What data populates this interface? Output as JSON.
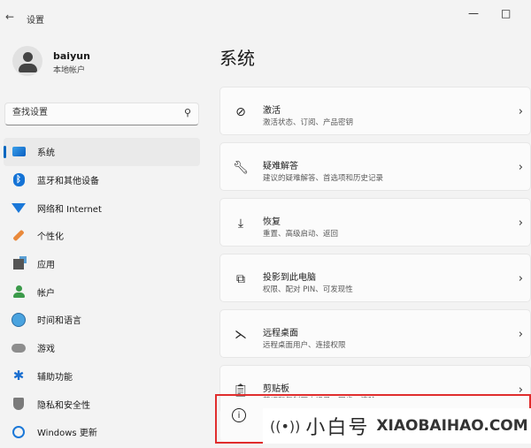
{
  "window": {
    "title": "设置",
    "back_icon": "back-arrow-icon",
    "minimize": "—",
    "maximize": "□"
  },
  "user": {
    "name": "baiyun",
    "account_type": "本地帐户"
  },
  "search": {
    "placeholder": "查找设置"
  },
  "sidebar": {
    "items": [
      {
        "label": "系统",
        "icon": "system-icon",
        "active": true
      },
      {
        "label": "蓝牙和其他设备",
        "icon": "bluetooth-icon"
      },
      {
        "label": "网络和 Internet",
        "icon": "wifi-icon"
      },
      {
        "label": "个性化",
        "icon": "brush-icon"
      },
      {
        "label": "应用",
        "icon": "apps-icon"
      },
      {
        "label": "帐户",
        "icon": "account-icon"
      },
      {
        "label": "时间和语言",
        "icon": "globe-clock-icon"
      },
      {
        "label": "游戏",
        "icon": "gamepad-icon"
      },
      {
        "label": "辅助功能",
        "icon": "accessibility-icon"
      },
      {
        "label": "隐私和安全性",
        "icon": "shield-icon"
      },
      {
        "label": "Windows 更新",
        "icon": "update-icon"
      }
    ]
  },
  "main": {
    "title": "系统",
    "cards": [
      {
        "title": "激活",
        "subtitle": "激活状态、订阅、产品密钥",
        "icon": "check-circle-icon"
      },
      {
        "title": "疑难解答",
        "subtitle": "建议的疑难解答、首选项和历史记录",
        "icon": "wrench-icon"
      },
      {
        "title": "恢复",
        "subtitle": "重置、高级启动、返回",
        "icon": "recovery-icon"
      },
      {
        "title": "投影到此电脑",
        "subtitle": "权限、配对 PIN、可发现性",
        "icon": "project-icon"
      },
      {
        "title": "远程桌面",
        "subtitle": "远程桌面用户、连接权限",
        "icon": "remote-desktop-icon"
      },
      {
        "title": "剪贴板",
        "subtitle": "剪切和复制历史记录、同步、清除",
        "icon": "clipboard-icon"
      }
    ],
    "about": {
      "icon": "info-icon"
    }
  },
  "watermark": {
    "cn": "小白号",
    "en": "XIAOBAIHAO.COM"
  },
  "colors": {
    "accent": "#0067c0",
    "highlight": "#e02d2d"
  }
}
